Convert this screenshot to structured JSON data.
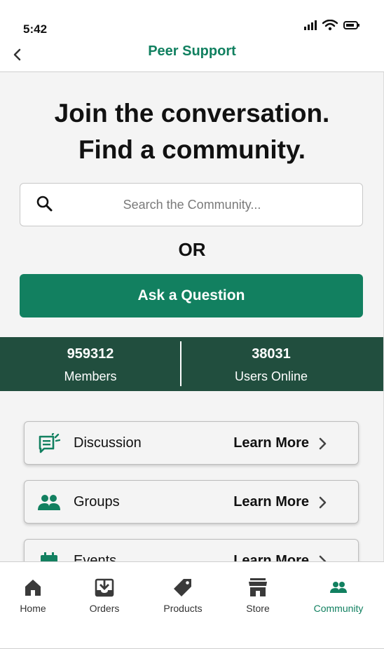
{
  "status_bar": {
    "time": "5:42"
  },
  "nav": {
    "title": "Peer Support"
  },
  "hero": {
    "line1": "Join the conversation.",
    "line2": "Find a community."
  },
  "search": {
    "placeholder": "Search the Community...",
    "value": ""
  },
  "or_label": "OR",
  "ask_button": {
    "label": "Ask a Question"
  },
  "stats": {
    "members": {
      "value": "959312",
      "label": "Members"
    },
    "online": {
      "value": "38031",
      "label": "Users Online"
    }
  },
  "cards": [
    {
      "title": "Discussion",
      "action": "Learn More",
      "icon": "discussion-icon"
    },
    {
      "title": "Groups",
      "action": "Learn More",
      "icon": "groups-icon"
    },
    {
      "title": "Events",
      "action": "Learn More",
      "icon": "calendar-icon"
    }
  ],
  "tabs": [
    {
      "label": "Home",
      "icon": "home-icon"
    },
    {
      "label": "Orders",
      "icon": "orders-icon"
    },
    {
      "label": "Products",
      "icon": "tag-icon"
    },
    {
      "label": "Store",
      "icon": "store-icon"
    },
    {
      "label": "Community",
      "icon": "community-icon",
      "active": true
    }
  ],
  "colors": {
    "brand_green": "#118060",
    "stats_band": "#214e3e",
    "background": "#f4f4f4"
  }
}
